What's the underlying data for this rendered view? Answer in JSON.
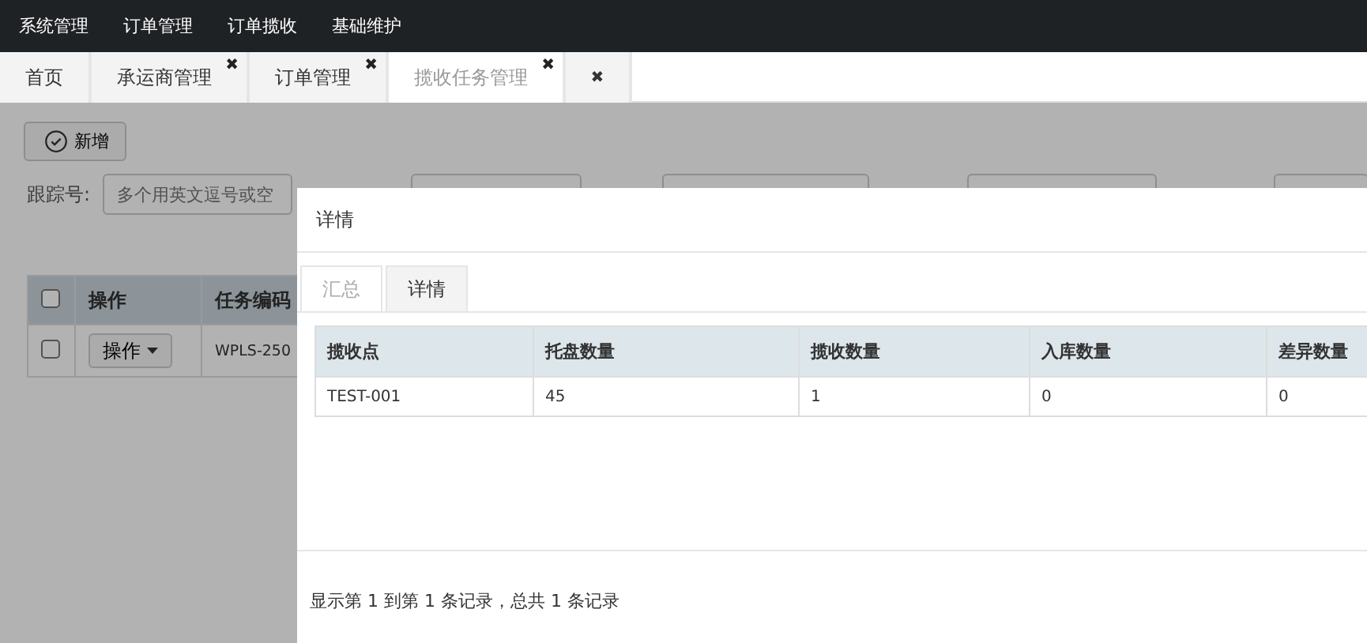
{
  "menu": [
    {
      "label": "系统管理"
    },
    {
      "label": "订单管理"
    },
    {
      "label": "订单揽收"
    },
    {
      "label": "基础维护"
    }
  ],
  "tabs": [
    {
      "label": "首页",
      "closable": false,
      "selected": false
    },
    {
      "label": "承运商管理",
      "closable": true,
      "selected": false
    },
    {
      "label": "订单管理",
      "closable": true,
      "selected": false
    },
    {
      "label": "揽收任务管理",
      "closable": true,
      "selected": true
    }
  ],
  "close_all": "✖",
  "close_mark": "✖",
  "toolbar": {
    "add_button": "新增"
  },
  "filters": {
    "label": "跟踪号:",
    "placeholder": "多个用英文逗号或空"
  },
  "task_table": {
    "select_all_checked": false,
    "columns": [
      "操作",
      "任务编码"
    ],
    "rows": [
      {
        "checked": false,
        "action": "操作",
        "code": "WPLS-250"
      }
    ]
  },
  "dialog": {
    "title": "详情",
    "tabs": [
      {
        "label": "汇总",
        "selected": true
      },
      {
        "label": "详情",
        "selected": false
      }
    ],
    "columns": [
      "揽收点",
      "托盘数量",
      "揽收数量",
      "入库数量",
      "差异数量"
    ],
    "rows": [
      [
        "TEST-001",
        "45",
        "1",
        "0",
        "0"
      ]
    ],
    "footer": "显示第 1 到第 1 条记录，总共 1 条记录"
  }
}
